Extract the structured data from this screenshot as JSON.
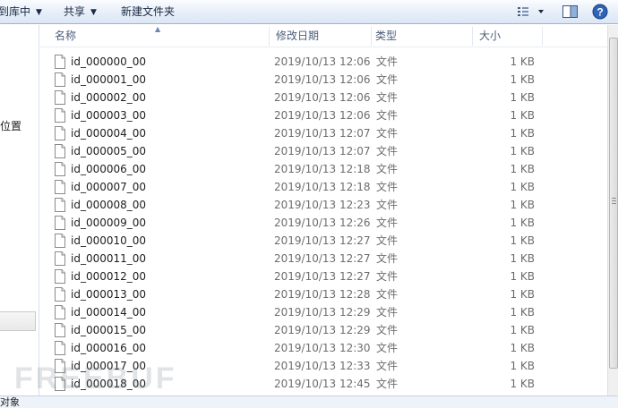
{
  "toolbar": {
    "include_in_library": "到库中",
    "share": "共享",
    "new_folder": "新建文件夹",
    "view_icon": "view-options-icon",
    "preview_icon": "preview-pane-icon",
    "help_icon": "help-icon"
  },
  "nav": {
    "partial_label": "位置"
  },
  "columns": {
    "name": "名称",
    "date": "修改日期",
    "type": "类型",
    "size": "大小"
  },
  "files": [
    {
      "name": "id_000000_00",
      "date": "2019/10/13 12:06",
      "type": "文件",
      "size": "1 KB"
    },
    {
      "name": "id_000001_00",
      "date": "2019/10/13 12:06",
      "type": "文件",
      "size": "1 KB"
    },
    {
      "name": "id_000002_00",
      "date": "2019/10/13 12:06",
      "type": "文件",
      "size": "1 KB"
    },
    {
      "name": "id_000003_00",
      "date": "2019/10/13 12:06",
      "type": "文件",
      "size": "1 KB"
    },
    {
      "name": "id_000004_00",
      "date": "2019/10/13 12:07",
      "type": "文件",
      "size": "1 KB"
    },
    {
      "name": "id_000005_00",
      "date": "2019/10/13 12:07",
      "type": "文件",
      "size": "1 KB"
    },
    {
      "name": "id_000006_00",
      "date": "2019/10/13 12:18",
      "type": "文件",
      "size": "1 KB"
    },
    {
      "name": "id_000007_00",
      "date": "2019/10/13 12:18",
      "type": "文件",
      "size": "1 KB"
    },
    {
      "name": "id_000008_00",
      "date": "2019/10/13 12:23",
      "type": "文件",
      "size": "1 KB"
    },
    {
      "name": "id_000009_00",
      "date": "2019/10/13 12:26",
      "type": "文件",
      "size": "1 KB"
    },
    {
      "name": "id_000010_00",
      "date": "2019/10/13 12:27",
      "type": "文件",
      "size": "1 KB"
    },
    {
      "name": "id_000011_00",
      "date": "2019/10/13 12:27",
      "type": "文件",
      "size": "1 KB"
    },
    {
      "name": "id_000012_00",
      "date": "2019/10/13 12:27",
      "type": "文件",
      "size": "1 KB"
    },
    {
      "name": "id_000013_00",
      "date": "2019/10/13 12:28",
      "type": "文件",
      "size": "1 KB"
    },
    {
      "name": "id_000014_00",
      "date": "2019/10/13 12:29",
      "type": "文件",
      "size": "1 KB"
    },
    {
      "name": "id_000015_00",
      "date": "2019/10/13 12:29",
      "type": "文件",
      "size": "1 KB"
    },
    {
      "name": "id_000016_00",
      "date": "2019/10/13 12:30",
      "type": "文件",
      "size": "1 KB"
    },
    {
      "name": "id_000017_00",
      "date": "2019/10/13 12:33",
      "type": "文件",
      "size": "1 KB"
    },
    {
      "name": "id_000018_00",
      "date": "2019/10/13 12:45",
      "type": "文件",
      "size": "1 KB"
    }
  ],
  "status": {
    "partial_text": "对象"
  },
  "watermark": "FREEBUF"
}
